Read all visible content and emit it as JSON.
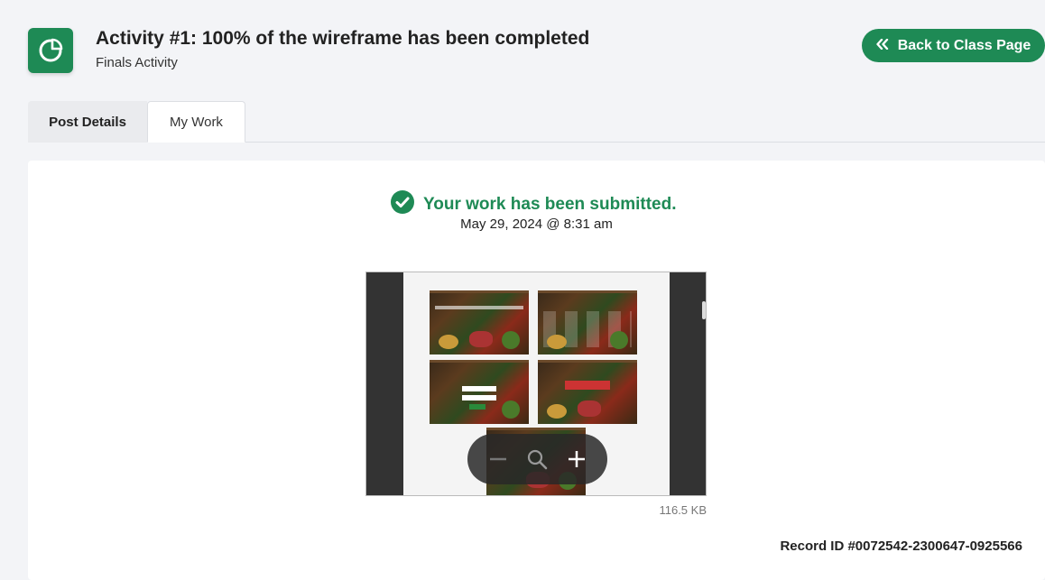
{
  "header": {
    "title": "Activity #1: 100% of the wireframe has been completed",
    "subtitle": "Finals Activity",
    "icon": "pie-chart-icon",
    "back_button_label": "Back to Class Page",
    "back_button_icon": "double-chevron-left-icon"
  },
  "tabs": [
    {
      "label": "Post Details",
      "active": false
    },
    {
      "label": "My Work",
      "active": true
    }
  ],
  "submission": {
    "status": "Your work has been submitted.",
    "status_icon": "check-circle-icon",
    "date": "May 29, 2024 @ 8:31 am"
  },
  "attachment": {
    "file_size": "116.5 KB",
    "zoom_controls": [
      "zoom-out-icon",
      "zoom-icon",
      "zoom-in-icon"
    ]
  },
  "record": {
    "text": "Record ID #0072542-2300647-0925566"
  },
  "colors": {
    "accent": "#1e8a55",
    "background": "#f3f4f7",
    "panel": "#ffffff"
  }
}
